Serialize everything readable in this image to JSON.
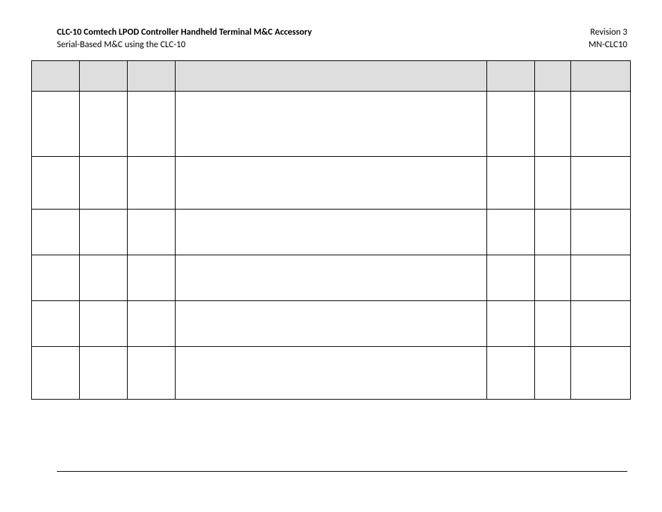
{
  "header": {
    "left_line1": "CLC-10 Comtech LPOD Controller Handheld Terminal M&C Accessory",
    "left_line2": "Serial-Based M&C using the CLC-10",
    "right_line1": "Revision 3",
    "right_line2": "MN-CLC10"
  },
  "table": {
    "columns": [
      "",
      "",
      "",
      "",
      "",
      "",
      ""
    ],
    "rows": [
      [
        "",
        "",
        "",
        "",
        "",
        "",
        ""
      ],
      [
        "",
        "",
        "",
        "",
        "",
        "",
        ""
      ],
      [
        "",
        "",
        "",
        "",
        "",
        "",
        ""
      ],
      [
        "",
        "",
        "",
        "",
        "",
        "",
        ""
      ],
      [
        "",
        "",
        "",
        "",
        "",
        "",
        ""
      ],
      [
        "",
        "",
        "",
        "",
        "",
        "",
        ""
      ]
    ]
  }
}
